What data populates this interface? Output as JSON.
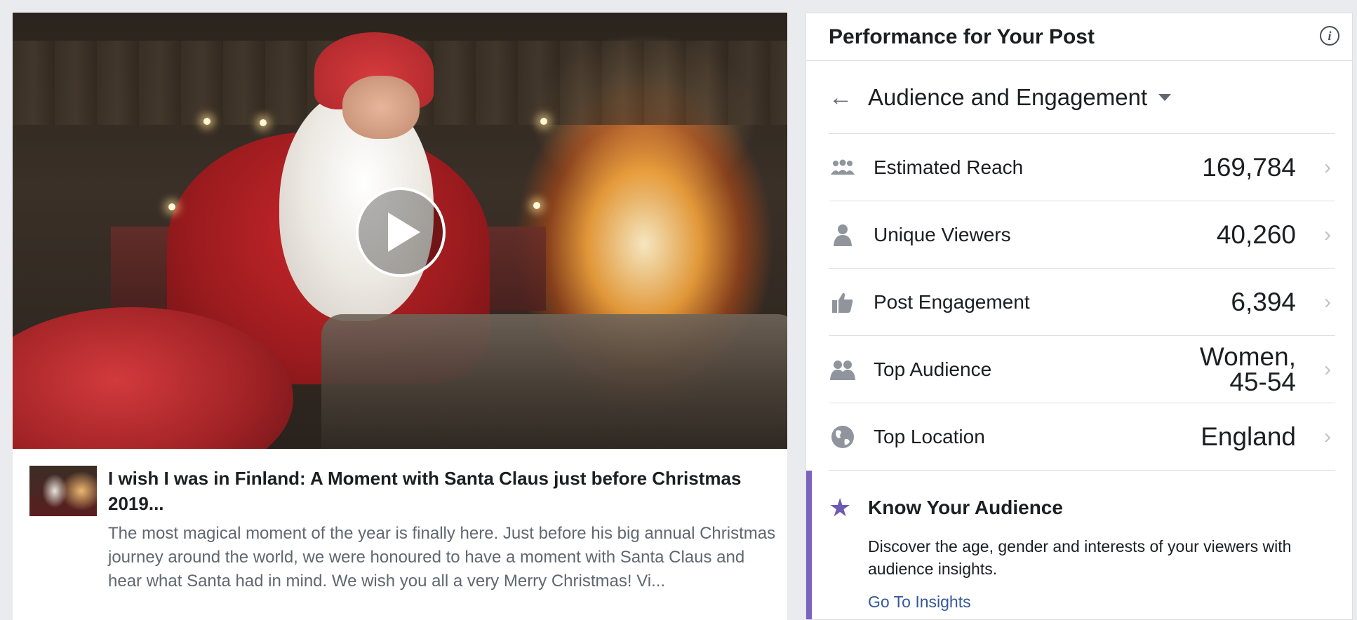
{
  "post": {
    "title": "I wish I was in Finland: A Moment with Santa Claus just before Christmas 2019...",
    "description": "The most magical moment of the year is finally here. Just before his big annual Christmas journey around the world, we were honoured to have a moment with Santa Claus and hear what Santa had in mind. We wish you all a very Merry Christmas! Vi...",
    "play_icon": "play-icon"
  },
  "panel": {
    "title": "Performance for Your Post",
    "info_icon": "info-icon",
    "section": {
      "title": "Audience and Engagement",
      "back_icon": "back-arrow-icon",
      "dropdown_icon": "caret-down-icon"
    },
    "metrics": [
      {
        "icon": "people-group-icon",
        "label": "Estimated Reach",
        "value": "169,784"
      },
      {
        "icon": "person-icon",
        "label": "Unique Viewers",
        "value": "40,260"
      },
      {
        "icon": "thumbs-up-icon",
        "label": "Post Engagement",
        "value": "6,394"
      },
      {
        "icon": "people-pair-icon",
        "label": "Top Audience",
        "value_line1": "Women,",
        "value_line2": "45-54"
      },
      {
        "icon": "globe-icon",
        "label": "Top Location",
        "value": "England"
      }
    ],
    "insights": {
      "icon": "star-icon",
      "title": "Know Your Audience",
      "description": "Discover the age, gender and interests of your viewers with audience insights.",
      "link": "Go To Insights"
    }
  },
  "colors": {
    "page_background": "#e9ebee",
    "accent_purple": "#7b64c0",
    "link_blue": "#365899",
    "icon_gray": "#90949c"
  }
}
